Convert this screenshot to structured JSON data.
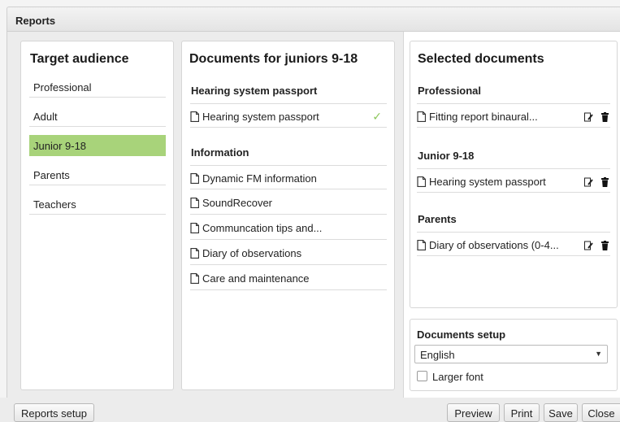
{
  "window": {
    "title": "Reports"
  },
  "audience": {
    "title": "Target audience",
    "items": [
      {
        "label": "Professional",
        "selected": false
      },
      {
        "label": "Adult",
        "selected": false
      },
      {
        "label": "Junior 9-18",
        "selected": true
      },
      {
        "label": "Parents",
        "selected": false
      },
      {
        "label": "Teachers",
        "selected": false
      }
    ]
  },
  "documents": {
    "title": "Documents for juniors 9-18",
    "groups": [
      {
        "label": "Hearing system passport",
        "items": [
          {
            "label": "Hearing system passport",
            "checked": true
          }
        ]
      },
      {
        "label": "Information",
        "items": [
          {
            "label": "Dynamic FM information"
          },
          {
            "label": "SoundRecover"
          },
          {
            "label": "Communcation tips and..."
          },
          {
            "label": "Diary of observations"
          },
          {
            "label": "Care and maintenance"
          }
        ]
      }
    ]
  },
  "selected": {
    "title": "Selected documents",
    "groups": [
      {
        "label": "Professional",
        "items": [
          {
            "label": "Fitting report binaural..."
          }
        ]
      },
      {
        "label": "Junior 9-18",
        "items": [
          {
            "label": "Hearing system passport"
          }
        ]
      },
      {
        "label": "Parents",
        "items": [
          {
            "label": "Diary of observations (0-4..."
          }
        ]
      }
    ]
  },
  "setup": {
    "title": "Documents setup",
    "language": "English",
    "larger_font_label": "Larger font",
    "larger_font_checked": false
  },
  "footer": {
    "reports_setup": "Reports setup",
    "preview": "Preview",
    "print": "Print",
    "save": "Save",
    "close": "Close"
  },
  "colors": {
    "selected_bg": "#a8d37a",
    "check": "#8cc65a"
  }
}
